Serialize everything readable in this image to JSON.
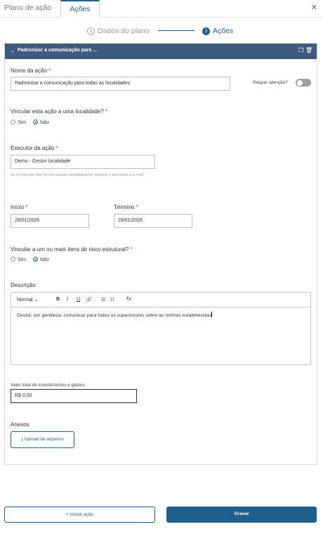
{
  "tabs": {
    "plan_label": "Plano de ação",
    "actions_label": "Ações",
    "close_glyph": "✕"
  },
  "stepper": {
    "step1_number": "1",
    "step1_label": "Dados do plano",
    "step2_number": "2",
    "step2_label": "Ações"
  },
  "card": {
    "collapse_glyph": "⌄",
    "title": "Padronizar a comunicação para ...",
    "copy_glyph": "❐",
    "delete_glyph": "🗑"
  },
  "form": {
    "action_name_label": "Nome da ação",
    "action_name_value": "Padronizar a comunicação para todas as localidades",
    "attention_label": "Requer atenção?",
    "link_location_label": "Vincular esta ação a uma localidade?",
    "yes_label": "Sim",
    "no_label": "Não",
    "executor_label": "Executor da ação",
    "executor_value": "Demo - Gestor localidade",
    "executor_hint": "Se o executor não for um usuário da plataforma, informe o seu nome e e-mail.",
    "start_label": "Início",
    "start_value": "28/01/2026",
    "end_label": "Término",
    "end_value": "29/01/2026",
    "link_risk_label": "Vincular a um ou mais itens de risco estrutural?",
    "description_label": "Descrição",
    "editor": {
      "format_select": "Normal",
      "format_chevron": "⌄",
      "bold": "B",
      "italic": "I",
      "underline": "U",
      "link": "🔗",
      "ordered_list": "☰",
      "bullet_list": "☷",
      "clear_format": "Tx",
      "content": "Gestor, por gentileza, comunicar para todos os supervisores sobre as normas estabelecidas"
    },
    "investment_label": "Valor total de investimentos e gastos",
    "investment_value": "R$ 0,00",
    "attachments_label": "Anexos",
    "upload_icon": "⤓",
    "upload_label": "Upload de arquivos",
    "required_mark": "*"
  },
  "footer": {
    "add_plus": "+",
    "add_action_label": "Incluir ação",
    "save_label": "Gravar"
  }
}
